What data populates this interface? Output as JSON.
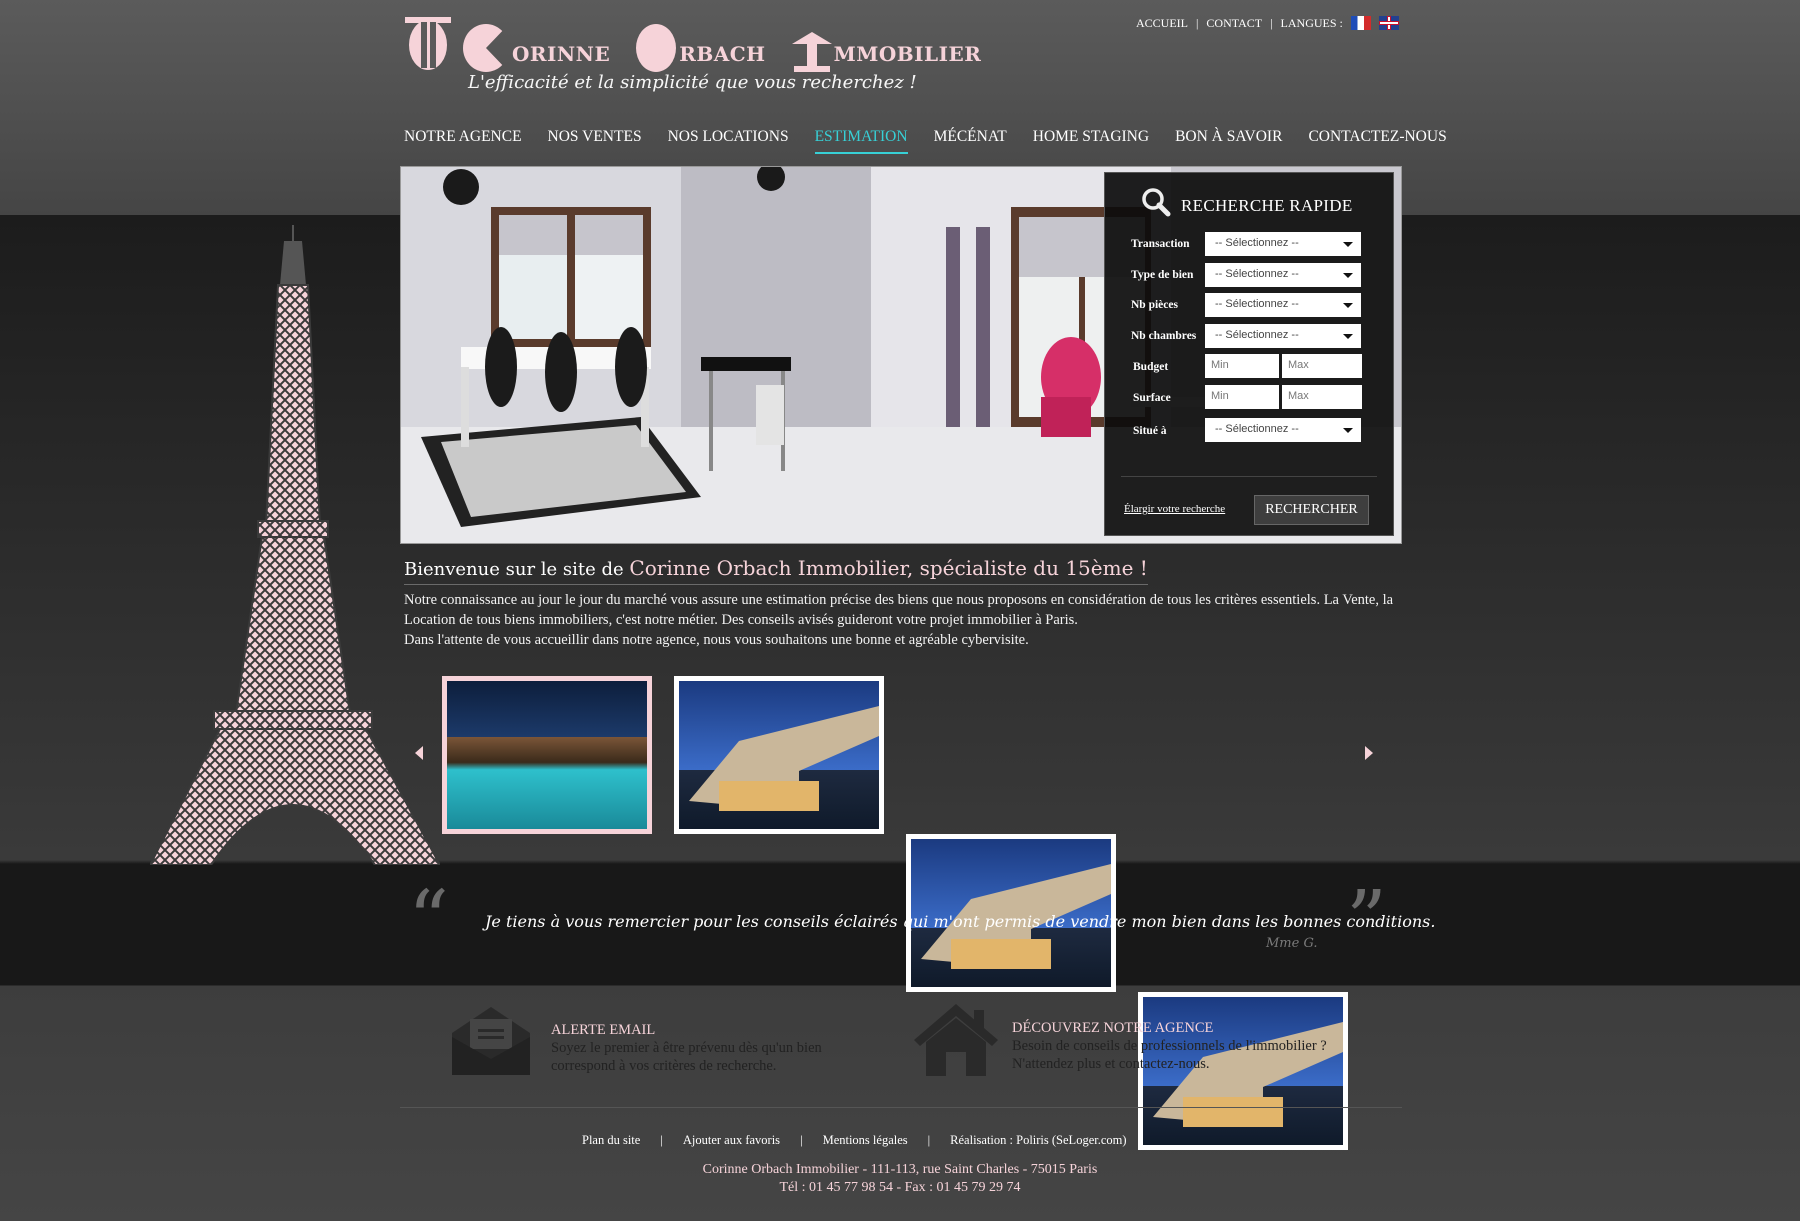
{
  "brand": {
    "words": [
      {
        "initial": "C",
        "rest": "ORINNE"
      },
      {
        "initial": "O",
        "rest": "RBACH"
      },
      {
        "initial": "I",
        "rest": "MMOBILIER"
      }
    ],
    "slogan": "L'efficacité et la simplicité que vous recherchez !"
  },
  "toplinks": {
    "accueil": "ACCUEIL",
    "contact": "CONTACT",
    "langues": "LANGUES :",
    "separator": "|"
  },
  "nav": [
    {
      "label": "NOTRE AGENCE",
      "active": false
    },
    {
      "label": "NOS VENTES",
      "active": false
    },
    {
      "label": "NOS LOCATIONS",
      "active": false
    },
    {
      "label": "ESTIMATION",
      "active": true
    },
    {
      "label": "MÉCÉNAT",
      "active": false
    },
    {
      "label": "HOME STAGING",
      "active": false
    },
    {
      "label": "BON À SAVOIR",
      "active": false
    },
    {
      "label": "CONTACTEZ-NOUS",
      "active": false
    }
  ],
  "search": {
    "title": "RECHERCHE RAPIDE",
    "fields": {
      "transaction": {
        "label": "Transaction",
        "value": "-- Sélectionnez --"
      },
      "type": {
        "label": "Type de bien",
        "value": "-- Sélectionnez --"
      },
      "pieces": {
        "label": "Nb pièces",
        "value": "-- Sélectionnez --"
      },
      "chambres": {
        "label": "Nb chambres",
        "value": "-- Sélectionnez --"
      },
      "budget": {
        "label": "Budget",
        "min": "Min",
        "max": "Max"
      },
      "surface": {
        "label": "Surface",
        "min": "Min",
        "max": "Max"
      },
      "situe": {
        "label": "Situé à",
        "value": "-- Sélectionnez --"
      }
    },
    "widen": "Élargir votre recherche",
    "button": "RECHERCHER"
  },
  "welcome": {
    "prefix": "Bienvenue sur le site de",
    "highlight": "Corinne Orbach Immobilier, spécialiste du 15ème !",
    "line1": "Notre connaissance au jour le jour du marché vous assure une estimation précise des biens que nous proposons en considération de tous les critères essentiels. La Vente, la Location de tous biens immobiliers, c'est notre métier. Des conseils avisés guideront votre projet immobilier à Paris.",
    "line2": "Dans l'attente de vous accueillir dans notre agence, nous vous souhaitons une bonne et agréable cybervisite."
  },
  "quote": {
    "open": "“",
    "close": "”",
    "text": "Je tiens à vous remercier pour les conseils éclairés qui m'ont permis de vendre mon bien dans les bonnes conditions.",
    "author": "Mme G."
  },
  "footer": {
    "alert": {
      "title": "ALERTE EMAIL",
      "text": "Soyez le premier à être prévenu dès qu'un bien correspond à vos critères de recherche."
    },
    "agency": {
      "title": "DÉCOUVREZ NOTRE AGENCE",
      "text": "Besoin de conseils de professionnels de l'immobilier ? N'attendez plus et contactez-nous."
    },
    "links": [
      "Plan du site",
      "Ajouter aux favoris",
      "Mentions légales",
      "Réalisation : Poliris (SeLoger.com)"
    ],
    "separator": "|",
    "address": "Corinne Orbach Immobilier - 111-113, rue Saint Charles - 75015 Paris",
    "phone": "Tél : 01 45 77 98 54 - Fax : 01 45 79 29 74"
  },
  "colors": {
    "accent_pink": "#f6d3d9",
    "active_nav": "#37d0d6"
  }
}
